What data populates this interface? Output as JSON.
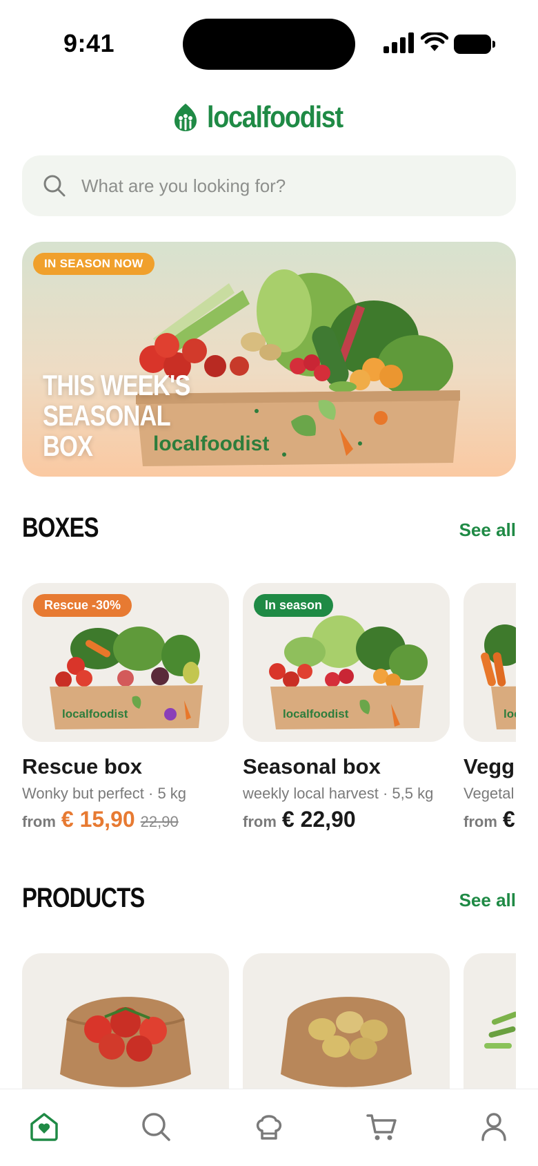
{
  "status_bar": {
    "time": "9:41"
  },
  "brand": {
    "name": "localfoodist",
    "color": "#1f8a45"
  },
  "search": {
    "placeholder": "What are you looking for?",
    "icon": "search-icon"
  },
  "hero": {
    "badge": "IN SEASON NOW",
    "title_line1": "THIS WEEK'S",
    "title_line2": "SEASONAL BOX",
    "box_print": "localfoodist"
  },
  "boxes_section": {
    "title": "BOXES",
    "see_all": "See all",
    "items": [
      {
        "badge": "Rescue -30%",
        "badge_color": "#e77a32",
        "name": "Rescue box",
        "description": "Wonky but perfect · 5 kg",
        "from": "from",
        "price": "€ 15,90",
        "old_price": "22,90",
        "box_print": "localfoodist"
      },
      {
        "badge": "In season",
        "badge_color": "#1f8a45",
        "name": "Seasonal box",
        "description": "weekly local harvest · 5,5 kg",
        "from": "from",
        "price": "€ 22,90",
        "box_print": "localfoodist"
      },
      {
        "name": "Vegg",
        "description": "Vegetal",
        "from": "from",
        "price": "€"
      }
    ]
  },
  "products_section": {
    "title": "PRODUCTS",
    "see_all": "See all",
    "items": [
      {
        "product": "tomatoes-in-paper-bag"
      },
      {
        "product": "potatoes-in-paper-bag"
      },
      {
        "product": "green-beans"
      }
    ]
  },
  "bottom_nav": {
    "items": [
      {
        "icon": "home-heart-icon",
        "active": true
      },
      {
        "icon": "search-icon",
        "active": false
      },
      {
        "icon": "chef-hat-icon",
        "active": false
      },
      {
        "icon": "cart-icon",
        "active": false
      },
      {
        "icon": "profile-icon",
        "active": false
      }
    ],
    "active_color": "#1f8a45",
    "inactive_color": "#7a7a7a"
  }
}
